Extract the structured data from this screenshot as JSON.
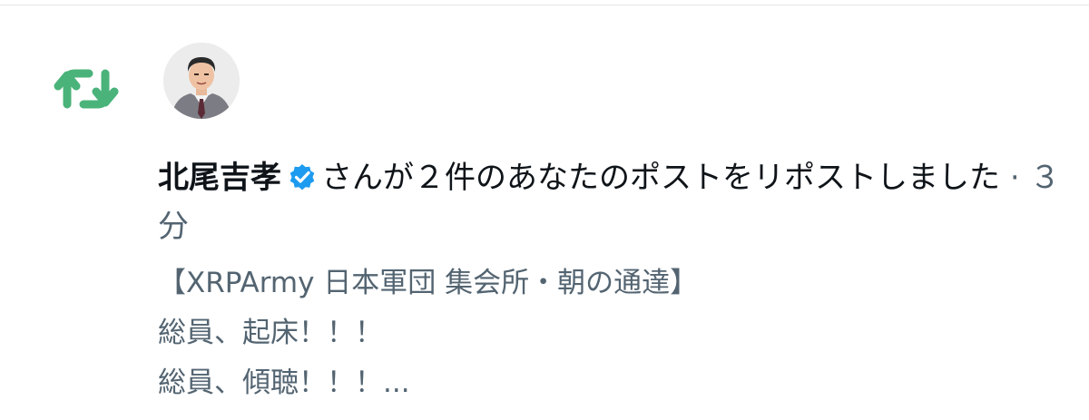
{
  "notification": {
    "user_name": "北尾吉孝",
    "action_text": "さんが２件のあなたのポストをリポストしました",
    "separator": "·",
    "time": "３分",
    "preview_lines": [
      "【XRPArmy 日本軍団 集会所・朝の通達】",
      "総員、起床！！！",
      "総員、傾聴！！！..."
    ]
  },
  "icons": {
    "repost": "repost-icon",
    "verified": "verified-badge-icon",
    "avatar": "avatar"
  },
  "colors": {
    "repost_green": "#4ab37a",
    "verified_blue": "#1d9bf0",
    "text_primary": "#0f1419",
    "text_secondary": "#536471"
  }
}
